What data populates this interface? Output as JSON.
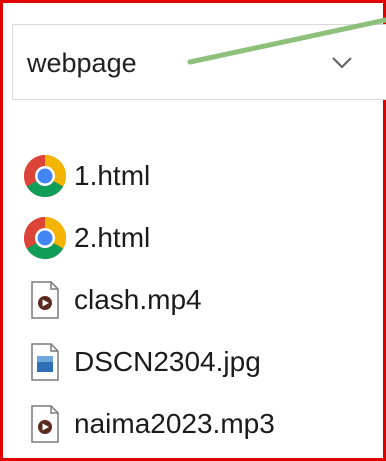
{
  "dropdown": {
    "value": "webpage"
  },
  "files": [
    {
      "name": "1.html",
      "icon": "chrome-icon"
    },
    {
      "name": "2.html",
      "icon": "chrome-icon"
    },
    {
      "name": "clash.mp4",
      "icon": "video-file-icon"
    },
    {
      "name": "DSCN2304.jpg",
      "icon": "image-file-icon"
    },
    {
      "name": "naima2023.mp3",
      "icon": "audio-file-icon"
    }
  ],
  "colors": {
    "highlight_border": "#e00000",
    "connector_line": "#8dc07a"
  }
}
